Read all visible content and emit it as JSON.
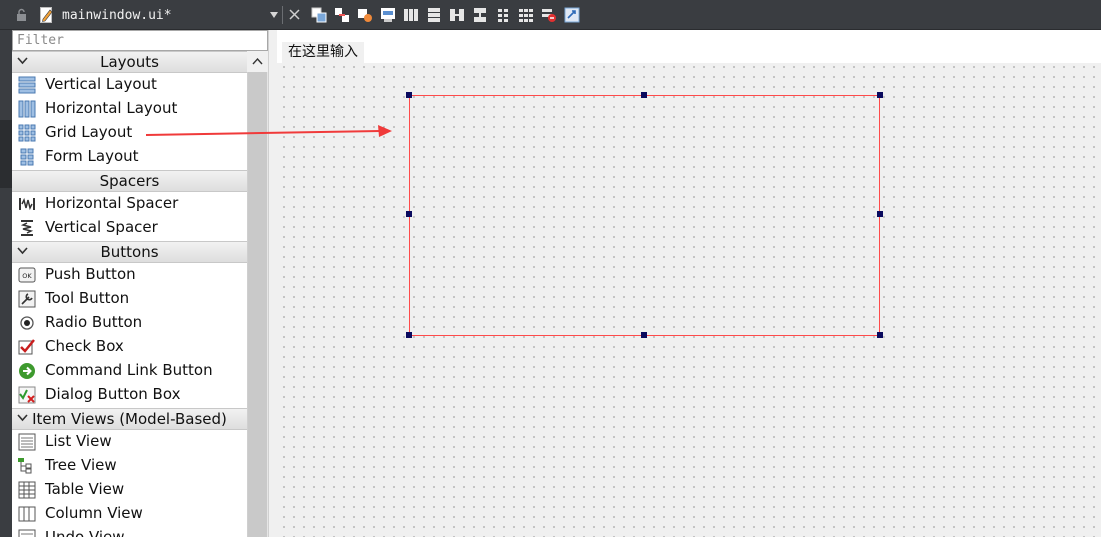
{
  "editor": {
    "file_name": "mainwindow.ui*",
    "icons": [
      "lock-icon",
      "file-icon",
      "dropdown-icon",
      "close-icon"
    ],
    "toolbar": [
      "edit-widgets-icon",
      "edit-signals-slots-icon",
      "edit-buddies-icon",
      "edit-tab-order-icon",
      "layout-horizontal-icon",
      "layout-vertical-icon",
      "layout-horizontal-splitter-icon",
      "layout-vertical-splitter-icon",
      "layout-form-icon",
      "layout-grid-icon",
      "break-layout-icon",
      "adjust-size-icon"
    ]
  },
  "widget_box": {
    "filter_placeholder": "Filter",
    "sections": [
      {
        "title": "Layouts",
        "items": [
          {
            "label": "Vertical Layout",
            "icon": "vertical-layout-icon"
          },
          {
            "label": "Horizontal Layout",
            "icon": "horizontal-layout-icon"
          },
          {
            "label": "Grid Layout",
            "icon": "grid-layout-icon"
          },
          {
            "label": "Form Layout",
            "icon": "form-layout-icon"
          }
        ]
      },
      {
        "title": "Spacers",
        "items": [
          {
            "label": "Horizontal Spacer",
            "icon": "horizontal-spacer-icon"
          },
          {
            "label": "Vertical Spacer",
            "icon": "vertical-spacer-icon"
          }
        ]
      },
      {
        "title": "Buttons",
        "items": [
          {
            "label": "Push Button",
            "icon": "push-button-icon"
          },
          {
            "label": "Tool Button",
            "icon": "tool-button-icon"
          },
          {
            "label": "Radio Button",
            "icon": "radio-button-icon"
          },
          {
            "label": "Check Box",
            "icon": "check-box-icon"
          },
          {
            "label": "Command Link Button",
            "icon": "command-link-icon"
          },
          {
            "label": "Dialog Button Box",
            "icon": "dialog-button-box-icon"
          }
        ]
      },
      {
        "title": "Item Views (Model-Based)",
        "items": [
          {
            "label": "List View",
            "icon": "list-view-icon"
          },
          {
            "label": "Tree View",
            "icon": "tree-view-icon"
          },
          {
            "label": "Table View",
            "icon": "table-view-icon"
          },
          {
            "label": "Column View",
            "icon": "column-view-icon"
          },
          {
            "label": "Undo View",
            "icon": "undo-view-icon"
          }
        ]
      }
    ]
  },
  "form": {
    "menu_placeholder": "在这里输入"
  },
  "colors": {
    "selection_border": "#ff4a4a",
    "handle": "#0a0a5e",
    "arrow": "#f03a3a",
    "topbar": "#3a3d41"
  }
}
